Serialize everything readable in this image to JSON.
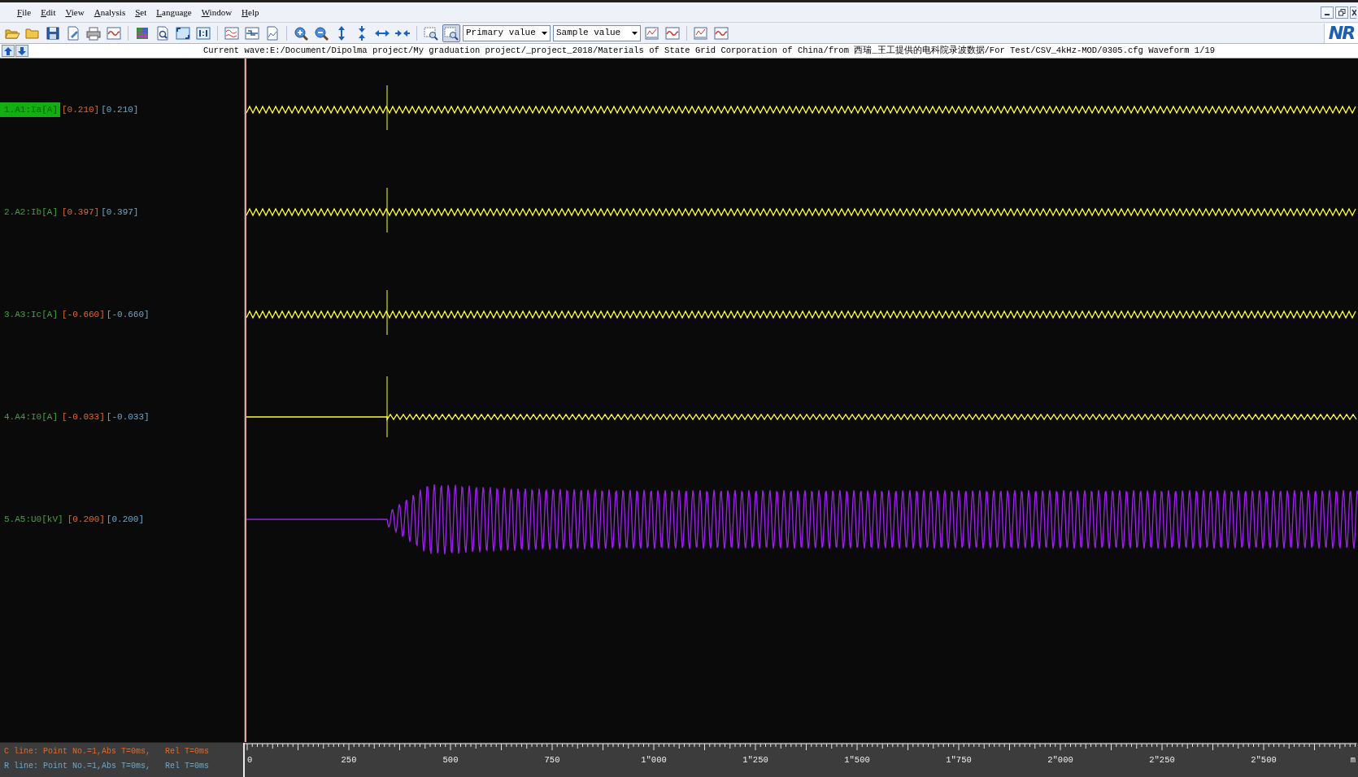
{
  "menu": [
    {
      "label": "File"
    },
    {
      "label": "Edit"
    },
    {
      "label": "View"
    },
    {
      "label": "Analysis"
    },
    {
      "label": "Set"
    },
    {
      "label": "Language"
    },
    {
      "label": "Window"
    },
    {
      "label": "Help"
    }
  ],
  "toolbar": [
    {
      "kind": "button",
      "pressed": false
    },
    {
      "kind": "button",
      "pressed": false
    },
    {
      "kind": "button",
      "pressed": false
    },
    {
      "kind": "button",
      "pressed": false
    },
    {
      "kind": "button",
      "pressed": false
    },
    {
      "kind": "button",
      "pressed": false
    },
    {
      "kind": "separator"
    },
    {
      "kind": "button",
      "pressed": false
    },
    {
      "kind": "button",
      "pressed": false
    },
    {
      "kind": "button",
      "pressed": false
    },
    {
      "kind": "button",
      "pressed": false
    },
    {
      "kind": "separator"
    },
    {
      "kind": "button",
      "pressed": false
    },
    {
      "kind": "button",
      "pressed": false
    },
    {
      "kind": "button",
      "pressed": false
    },
    {
      "kind": "separator"
    },
    {
      "kind": "button",
      "pressed": false
    },
    {
      "kind": "button",
      "pressed": false
    },
    {
      "kind": "button",
      "pressed": false
    },
    {
      "kind": "button",
      "pressed": false
    },
    {
      "kind": "button",
      "pressed": false
    },
    {
      "kind": "button",
      "pressed": false
    },
    {
      "kind": "separator"
    },
    {
      "kind": "button",
      "pressed": false
    },
    {
      "kind": "button",
      "pressed": true
    },
    {
      "kind": "dropdown",
      "value": "Primary value"
    },
    {
      "kind": "dropdown",
      "value": "Sample value"
    },
    {
      "kind": "button",
      "pressed": false
    },
    {
      "kind": "button",
      "pressed": false
    },
    {
      "kind": "separator"
    },
    {
      "kind": "button",
      "pressed": false
    },
    {
      "kind": "button",
      "pressed": false
    }
  ],
  "logo": "NR",
  "info_line": "Current wave:E:/Document/Dipolma project/My graduation project/_project_2018/Materials of State Grid Corporation of China/from 西瑞_王工提供的电科院录波数据/For Test/CSV_4kHz-MOD/0305.cfg  Waveform 1/19",
  "channels": [
    {
      "name": "1.A1:Ia[A]",
      "value_c": "[0.210]",
      "value_r": "[0.210]",
      "selected": true,
      "color": "#ffff33",
      "kind": "steady"
    },
    {
      "name": "2.A2:Ib[A]",
      "value_c": "[0.397]",
      "value_r": "[0.397]",
      "selected": false,
      "color": "#ffff33",
      "kind": "steady"
    },
    {
      "name": "3.A3:Ic[A]",
      "value_c": "[-0.660]",
      "value_r": "[-0.660]",
      "selected": false,
      "color": "#ffff33",
      "kind": "steady"
    },
    {
      "name": "4.A4:I0[A]",
      "value_c": "[-0.033]",
      "value_r": "[-0.033]",
      "selected": false,
      "color": "#ffff33",
      "kind": "onset"
    },
    {
      "name": "5.A5:U0[kV]",
      "value_c": "[0.200]",
      "value_r": "[0.200]",
      "selected": false,
      "color": "#a020f0",
      "kind": "burst"
    }
  ],
  "status": [
    {
      "kind": "c_line",
      "text": "C line: Point No.=1,Abs T=0ms,   Rel T=0ms"
    },
    {
      "kind": "r_line",
      "text": "R line: Point No.=1,Abs T=0ms,   Rel T=0ms"
    }
  ],
  "ruler_labels": [
    "0",
    "250",
    "500",
    "750",
    "1″000",
    "1″250",
    "1″500",
    "1″750",
    "2″000",
    "2″250",
    "2″500",
    "m"
  ]
}
